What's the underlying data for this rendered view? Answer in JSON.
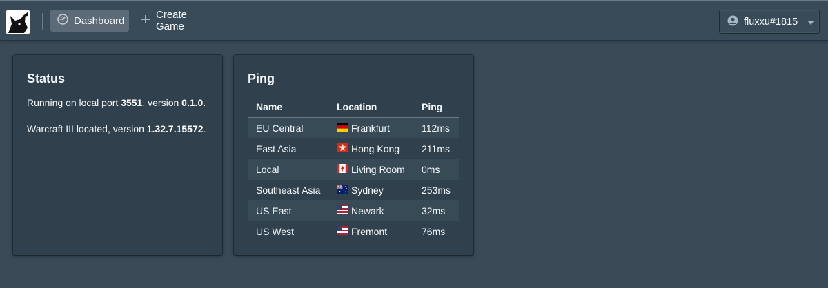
{
  "navbar": {
    "logo_name": "logo",
    "dashboard_label": "Dashboard",
    "create_game_label": "Create Game",
    "user_label": "fluxxu#1815"
  },
  "status": {
    "title": "Status",
    "line1_pre": "Running on local port ",
    "port": "3551",
    "line1_mid": ", version ",
    "version": "0.1.0",
    "line1_post": ".",
    "line2_pre": "Warcraft III located, version ",
    "wc3_version": "1.32.7.15572",
    "line2_post": "."
  },
  "ping": {
    "title": "Ping",
    "headers": [
      "Name",
      "Location",
      "Ping"
    ],
    "rows": [
      {
        "name": "EU Central",
        "flag": "germany-flag",
        "location": "Frankfurt",
        "ping": "112ms",
        "status": "ok"
      },
      {
        "name": "East Asia",
        "flag": "hong-kong-flag",
        "location": "Hong Kong",
        "ping": "211ms",
        "status": "warn"
      },
      {
        "name": "Local",
        "flag": "canada-flag",
        "location": "Living Room",
        "ping": "0ms",
        "status": "ok"
      },
      {
        "name": "Southeast Asia",
        "flag": "australia-flag",
        "location": "Sydney",
        "ping": "253ms",
        "status": "bad"
      },
      {
        "name": "US East",
        "flag": "usa-flag",
        "location": "Newark",
        "ping": "32ms",
        "status": "ok"
      },
      {
        "name": "US West",
        "flag": "usa-flag",
        "location": "Fremont",
        "ping": "76ms",
        "status": "ok"
      }
    ]
  },
  "colors": {
    "background": "#3a4a57",
    "card": "#30404d",
    "ping_ok": "#3dcc91",
    "ping_warn": "#ff9d52",
    "ping_bad": "#ff6b6b"
  }
}
